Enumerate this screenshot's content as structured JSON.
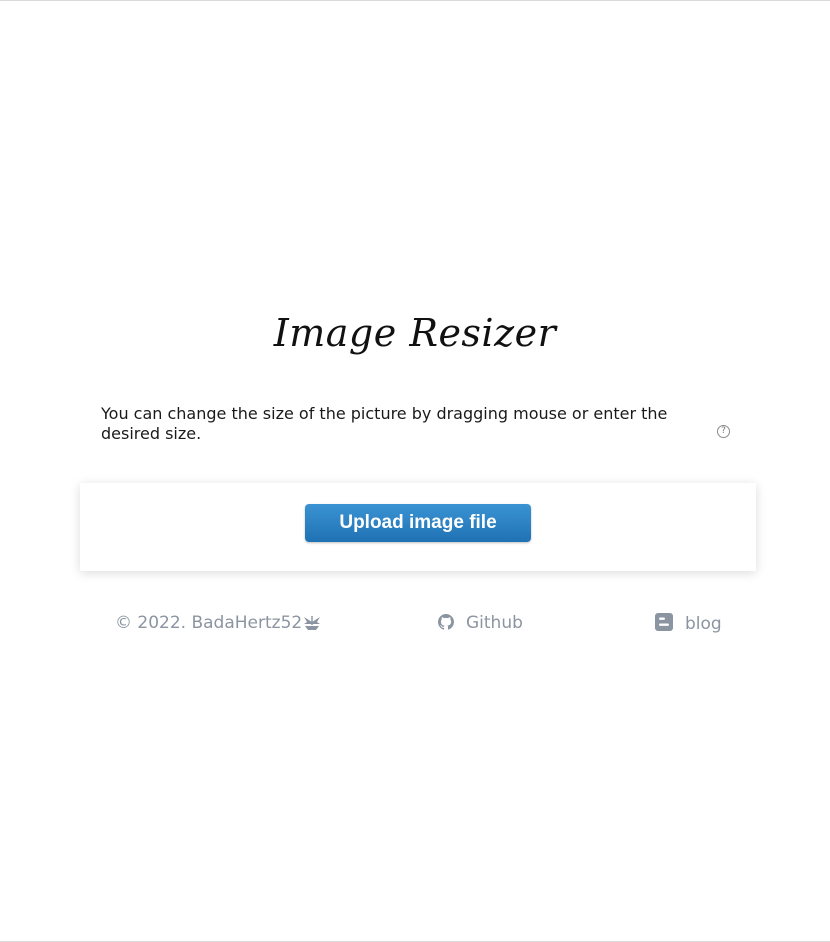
{
  "header": {
    "title": "Image Resizer"
  },
  "main": {
    "description": "You can change the size of the picture by dragging mouse or enter the desired size.",
    "help_icon": "question-circle-icon",
    "upload": {
      "button_label": "Upload image file",
      "button_color": "#2a82c5"
    }
  },
  "footer": {
    "copyright": "© 2022. BadaHertz52",
    "copyright_icon": "boat-icon",
    "github_label": "Github",
    "github_icon": "github-icon",
    "blog_label": "blog",
    "blog_icon": "blogger-icon",
    "text_color": "#8b95a1"
  }
}
